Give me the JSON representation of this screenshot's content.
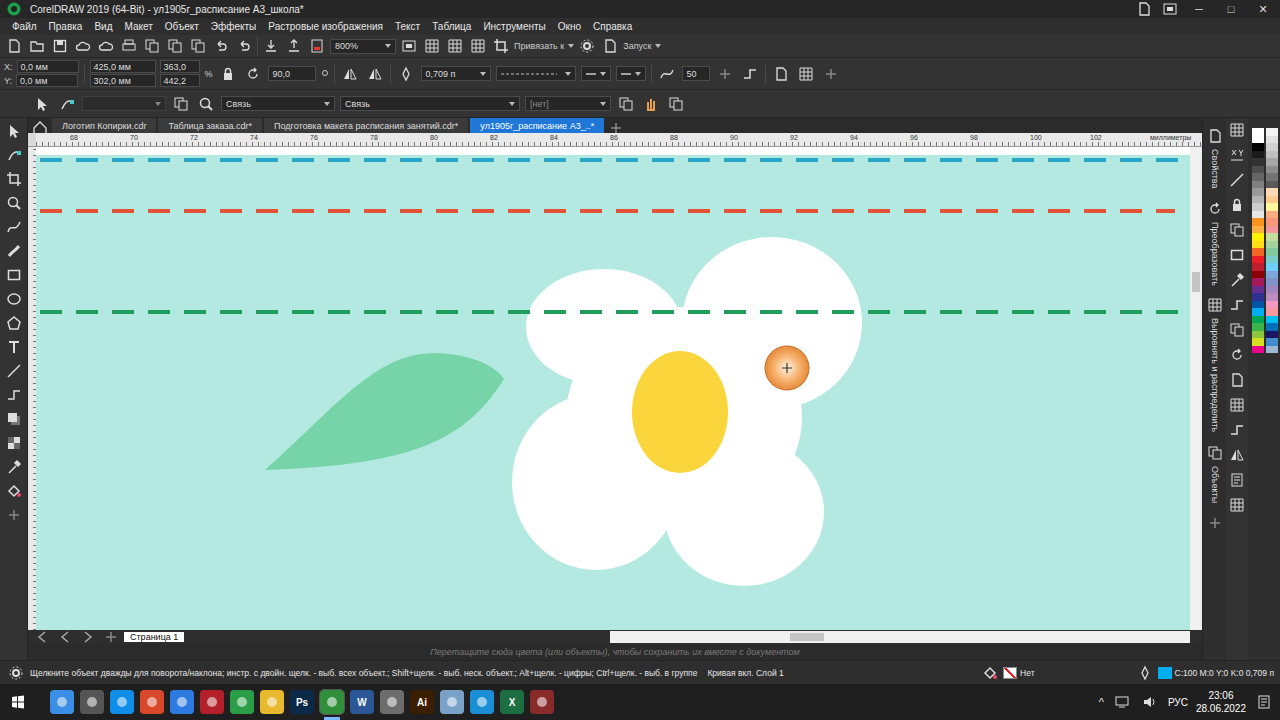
{
  "window": {
    "title": "CorelDRAW 2019 (64-Bit) - ул1905г_расписание А3_школа*",
    "controls": [
      "─",
      "□",
      "✕"
    ]
  },
  "menu": [
    "Файл",
    "Правка",
    "Вид",
    "Макет",
    "Объект",
    "Эффекты",
    "Растровые изображения",
    "Текст",
    "Таблица",
    "Инструменты",
    "Окно",
    "Справка"
  ],
  "toolbar": {
    "zoom": "800%",
    "snap": "Привязать к",
    "launch": "Запуск"
  },
  "property_bar": {
    "x_label": "X:",
    "x": "0,0 мм",
    "y_label": "Y:",
    "y": "0,0 мм",
    "width": "425,0 мм",
    "height": "302,0 мм",
    "scale_x": "363,0",
    "scale_y": "442,2",
    "percent": "%",
    "angle": "90,0",
    "outline": "0,709 п",
    "smoothing": "50"
  },
  "bar3": {
    "field1": "Связь",
    "field2": "Связь",
    "field3": "[нет]"
  },
  "doc_tabs": [
    {
      "label": "Логотип Копирки.cdr",
      "selected": false
    },
    {
      "label": "Таблица заказа.cdr*",
      "selected": false
    },
    {
      "label": "Подготовка макета расписания занятий.cdr*",
      "selected": false
    },
    {
      "label": "ул1905г_расписание А3_..*",
      "selected": true
    }
  ],
  "ruler": {
    "marks": [
      "68",
      "70",
      "72",
      "74",
      "76",
      "78",
      "80",
      "82",
      "84",
      "86",
      "88",
      "90",
      "92",
      "94",
      "96",
      "98",
      "100",
      "102"
    ],
    "unit": "миллиметры"
  },
  "dockers": [
    "Свойства",
    "Преобразовать",
    "Выровнять и распределить",
    "Объекты"
  ],
  "palette": [
    "#ffffff",
    "#ffffff",
    "#000000",
    "#1a1a1a",
    "#333333",
    "#4d4d4d",
    "#666666",
    "#808080",
    "#999999",
    "#b3b3b3",
    "#cccccc",
    "#e6e6e6",
    "#f7941d",
    "#fbb040",
    "#fff200",
    "#ffde17",
    "#f26522",
    "#ed1c24",
    "#be1e2d",
    "#8b0000",
    "#a3195b",
    "#662d91",
    "#2e3192",
    "#0054a6",
    "#00aeef",
    "#00a651",
    "#39b54a",
    "#8dc63f",
    "#d7df23",
    "#ec008c",
    "#f2f2f2",
    "#e0e0e0",
    "#d0d0d0",
    "#c0c0c0",
    "#a6a6a6",
    "#8c8c8c",
    "#737373",
    "#595959",
    "#fdd9b5",
    "#fcc98f",
    "#fff799",
    "#f9ad81",
    "#f7977a",
    "#f5989d",
    "#c4df9b",
    "#a3d39c",
    "#82ca9c",
    "#7accc8",
    "#6dcff6",
    "#7da7d9",
    "#8393ca",
    "#a187be",
    "#bd8cbf",
    "#f49ac1",
    "#f6989d",
    "#00bff3",
    "#0072bc",
    "#1b1464",
    "#448ccb",
    "#a0b8d8"
  ],
  "page_bar": {
    "page": "Страница 1"
  },
  "color_hint": "Перетащите сюда цвета (или объекты), чтобы сохранить их вместе с документом",
  "status_bar": {
    "hint": "Щелкните объект дважды для поворота/наклона; инстр. с двойн. щелк. - выб. всех объект.; Shift+щелк. - выб. неск. объект.; Alt+щелк. - цифры; Ctrl+щелк. - выб. в группе",
    "object": "Кривая вкл. Слой 1",
    "fill": "Нет",
    "outline": "C:100 M:0 Y:0 K:0  0,709 п"
  },
  "taskbar": {
    "apps": [
      {
        "label": "",
        "color": "#3a8ee6",
        "selected": false
      },
      {
        "label": "",
        "color": "#555555",
        "selected": false
      },
      {
        "label": "",
        "color": "#0e8ee9",
        "selected": false
      },
      {
        "label": "",
        "color": "#d9482b",
        "selected": false
      },
      {
        "label": "",
        "color": "#2d7be0",
        "selected": false
      },
      {
        "label": "",
        "color": "#b3202a",
        "selected": false
      },
      {
        "label": "",
        "color": "#2a9d47",
        "selected": false
      },
      {
        "label": "",
        "color": "#e8b82d",
        "selected": false
      },
      {
        "label": "Ps",
        "color": "#0b2a4a",
        "selected": false
      },
      {
        "label": "",
        "color": "#2f8f3a",
        "selected": true
      },
      {
        "label": "W",
        "color": "#2b5797",
        "selected": false
      },
      {
        "label": "",
        "color": "#6d6d6d",
        "selected": false
      },
      {
        "label": "Ai",
        "color": "#3b1d00",
        "selected": false
      },
      {
        "label": "",
        "color": "#7aa2c8",
        "selected": false
      },
      {
        "label": "",
        "color": "#1a8fd6",
        "selected": false
      },
      {
        "label": "X",
        "color": "#1d6f42",
        "selected": false
      },
      {
        "label": "",
        "color": "#8a2b2b",
        "selected": false
      }
    ],
    "tray_arrow": "^",
    "language": "РУС",
    "time": "23:06",
    "date": "28.06.2022"
  }
}
